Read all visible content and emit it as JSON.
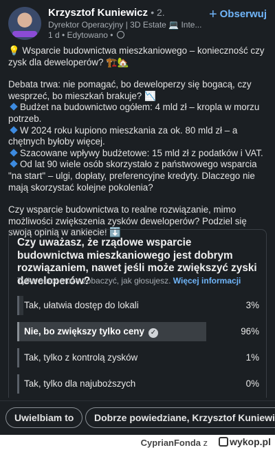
{
  "author": {
    "name": "Krzysztof Kuniewicz",
    "degree": "• 2.",
    "headline": "Dyrektor Operacyjny | 3D Estate 💻 Inte...",
    "meta": "1 d • Edytowano •"
  },
  "follow_label": "Obserwuj",
  "post": {
    "title": "Wsparcie budownictwa mieszkaniowego – konieczność czy zysk dla deweloperów? 🏗️🏡",
    "intro": "Debata trwa: nie pomagać, bo deweloperzy się bogacą, czy wesprzeć, bo mieszkań brakuje? 📉",
    "bullets": [
      "Budżet na budownictwo ogółem: 4 mld zł – kropla w morzu potrzeb.",
      "W 2024 roku kupiono mieszkania za ok. 80 mld zł – a chętnych byłoby więcej.",
      "Szacowane wpływy budżetowe: 15 mld zł z podatków i VAT.",
      "Od lat 90 wiele osób skorzystało z państwowego wsparcia \"na start\" – ulgi, dopłaty, preferencyjne kredyty. Dlaczego nie mają skorzystać kolejne pokolenia?"
    ],
    "closing": "Czy wsparcie budownictwa to realne rozwiązanie, mimo możliwości zwiększenia zysków deweloperów? Podziel się swoją opinią w ankiecie! ⬇️"
  },
  "poll": {
    "question": "Czy uważasz, że rządowe wsparcie budownictwa mieszkaniowego jest dobrym rozwiązaniem, nawet jeśli może zwiększyć zyski deweloperów?",
    "note": "Tylko autor może zobaczyć, jak głosujesz.",
    "more_info": "Więcej informacji",
    "options": [
      {
        "label": "Tak, ułatwia dostęp do lokali",
        "percent_text": "3%",
        "percent": 3,
        "selected": false
      },
      {
        "label": "Nie, bo zwiększy tylko ceny",
        "percent_text": "96%",
        "percent": 96,
        "selected": true
      },
      {
        "label": "Tak, tylko z kontrolą zysków",
        "percent_text": "1%",
        "percent": 1,
        "selected": false
      },
      {
        "label": "Tak, tylko dla najuboższych",
        "percent_text": "0%",
        "percent": 0,
        "selected": false
      }
    ]
  },
  "reactions": {
    "chip1": "Uwielbiam to",
    "chip2": "Dobrze powiedziane, Krzysztof Kuniewicz"
  },
  "watermark": {
    "user": "CyprianFonda",
    "sep": "z",
    "site": "wykop.pl"
  },
  "colors": {
    "background": "#1b1f23",
    "accent": "#70b5f9",
    "bullet": "#3d8be0"
  }
}
